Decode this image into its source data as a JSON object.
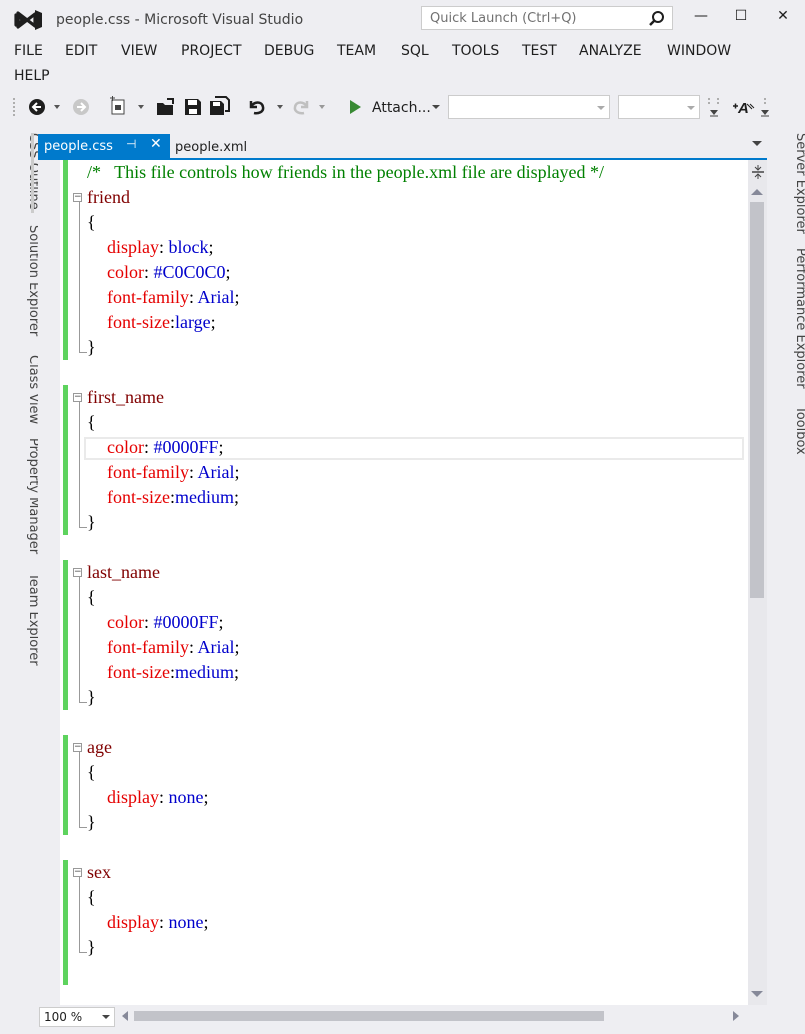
{
  "window": {
    "title": "people.css - Microsoft Visual Studio",
    "quick_launch_placeholder": "Quick Launch (Ctrl+Q)",
    "minimize": "—",
    "maximize": "☐",
    "close": "✕"
  },
  "menu": [
    "FILE",
    "EDIT",
    "VIEW",
    "PROJECT",
    "DEBUG",
    "TEAM",
    "SQL",
    "TOOLS",
    "TEST",
    "ANALYZE",
    "WINDOW",
    "HELP"
  ],
  "toolbar": {
    "attach_label": "Attach...",
    "icons": [
      "back-icon",
      "forward-icon",
      "new-project-icon",
      "open-file-icon",
      "save-icon",
      "save-all-icon",
      "undo-icon",
      "redo-icon",
      "start-icon"
    ]
  },
  "left_panels": [
    "CSS Outline",
    "Solution Explorer",
    "Class View",
    "Property Manager",
    "Team Explorer"
  ],
  "right_panels": [
    "Server Explorer",
    "Performance Explorer",
    "Toolbox"
  ],
  "tabs": {
    "active": "people.css",
    "inactive": "people.xml",
    "pin": "⊣",
    "close": "✕"
  },
  "editor": {
    "comment": "/*   This file controls how friends in the people.xml file are displayed */",
    "rules": [
      {
        "selector": "friend",
        "declarations": [
          {
            "prop": "display",
            "sep": ": ",
            "value": "block"
          },
          {
            "prop": "color",
            "sep": ": ",
            "value": "#C0C0C0"
          },
          {
            "prop": "font-family",
            "sep": ": ",
            "value": "Arial"
          },
          {
            "prop": "font-size",
            "sep": ":",
            "value": "large"
          }
        ]
      },
      {
        "selector": "first_name",
        "declarations": [
          {
            "prop": "color",
            "sep": ": ",
            "value": "#0000FF"
          },
          {
            "prop": "font-family",
            "sep": ": ",
            "value": "Arial"
          },
          {
            "prop": "font-size",
            "sep": ":",
            "value": "medium"
          }
        ]
      },
      {
        "selector": "last_name",
        "declarations": [
          {
            "prop": "color",
            "sep": ": ",
            "value": "#0000FF"
          },
          {
            "prop": "font-family",
            "sep": ": ",
            "value": "Arial"
          },
          {
            "prop": "font-size",
            "sep": ":",
            "value": "medium"
          }
        ]
      },
      {
        "selector": "age",
        "declarations": [
          {
            "prop": "display",
            "sep": ": ",
            "value": "none"
          }
        ]
      },
      {
        "selector": "sex",
        "declarations": [
          {
            "prop": "display",
            "sep": ": ",
            "value": "none"
          }
        ]
      }
    ],
    "open_brace": "{",
    "close_brace": "}",
    "semicolon": ";"
  },
  "status": {
    "zoom": "100 %"
  },
  "colors": {
    "accent": "#007acc",
    "change_bar": "#5ed35e",
    "comment": "#008000",
    "selector": "#800000",
    "property": "#e50000",
    "value": "#0000cc"
  }
}
